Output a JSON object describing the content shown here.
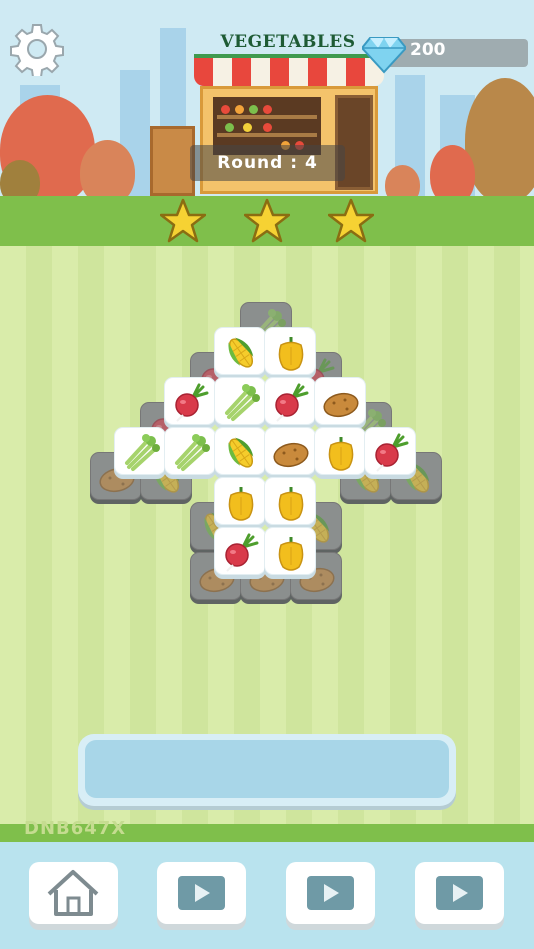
{
  "header": {
    "shop_sign": "VEGETABLES",
    "gem_count": "200",
    "round_label": "Round :  4"
  },
  "stars": {
    "earned": 3,
    "total": 3
  },
  "board": {
    "tiles_top": [
      {
        "item": "corn"
      },
      {
        "item": "pepper"
      },
      {
        "item": "radish"
      },
      {
        "item": "celery"
      },
      {
        "item": "radish"
      },
      {
        "item": "potato"
      },
      {
        "item": "celery"
      },
      {
        "item": "celery"
      },
      {
        "item": "corn"
      },
      {
        "item": "potato"
      },
      {
        "item": "pepper"
      },
      {
        "item": "radish"
      },
      {
        "item": "pepper"
      },
      {
        "item": "pepper"
      },
      {
        "item": "radish"
      },
      {
        "item": "pepper"
      }
    ]
  },
  "tray": {
    "slots_filled": 0
  },
  "footer": {
    "device_code": "DNB647X",
    "buttons": [
      {
        "icon": "home-icon"
      },
      {
        "icon": "play-icon"
      },
      {
        "icon": "play-icon"
      },
      {
        "icon": "play-icon"
      }
    ]
  },
  "colors": {
    "grass": "#7fbf4b",
    "sky": "#cfeaf3",
    "tray": "#a8d6e8",
    "star": "#f6d233"
  }
}
